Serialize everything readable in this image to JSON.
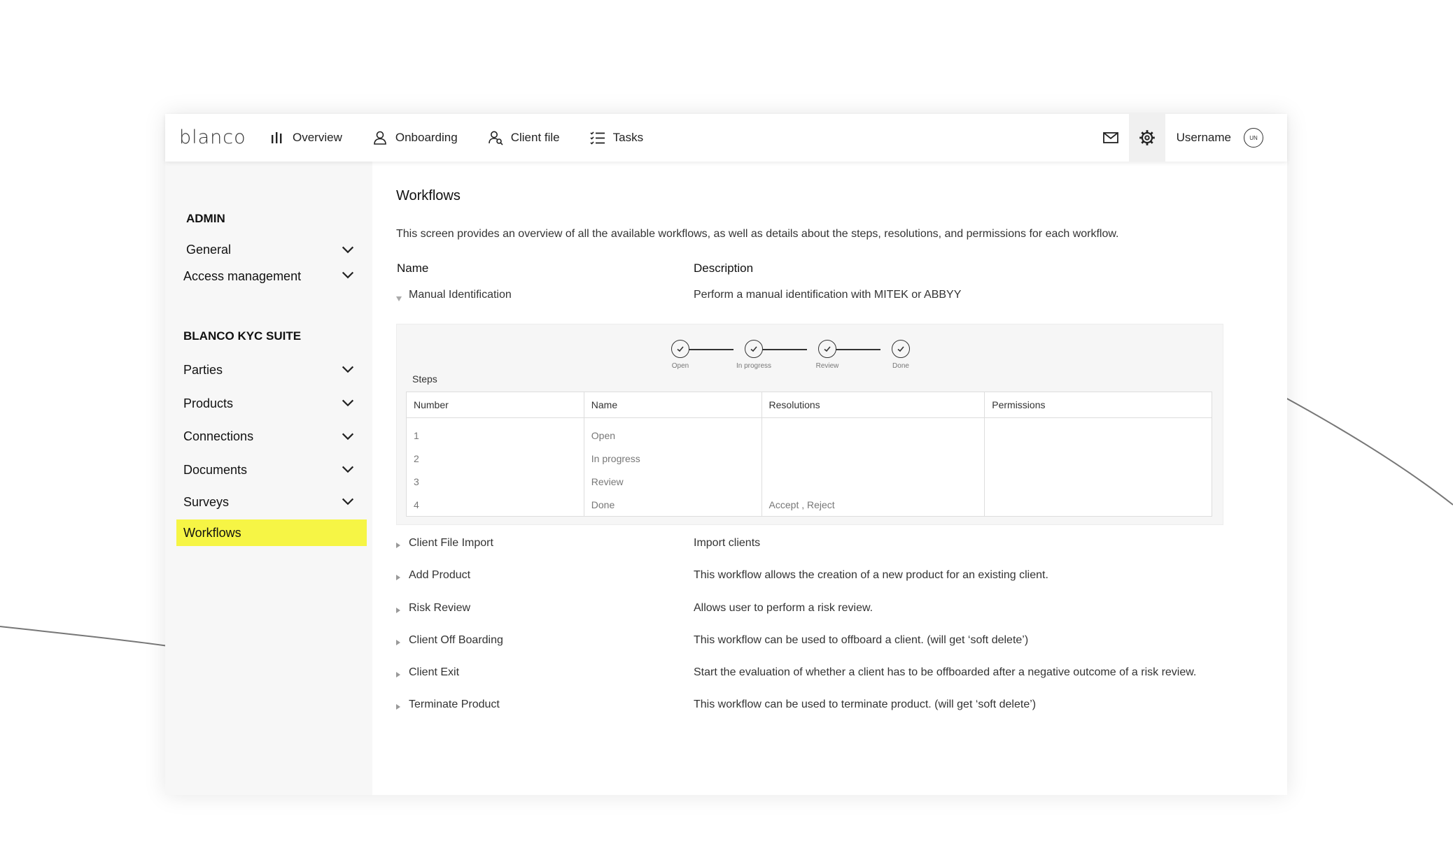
{
  "app": {
    "logo": "blanco"
  },
  "nav": {
    "items": [
      {
        "label": "Overview",
        "icon": "bar-chart-icon"
      },
      {
        "label": "Onboarding",
        "icon": "user-icon"
      },
      {
        "label": "Client file",
        "icon": "user-search-icon"
      },
      {
        "label": "Tasks",
        "icon": "task-list-icon"
      }
    ],
    "username": "Username",
    "avatar_initials": "UN"
  },
  "sidebar": {
    "admin_title": "ADMIN",
    "admin_items": [
      {
        "label": "General"
      },
      {
        "label": "Access management"
      }
    ],
    "suite_title": "BLANCO KYC SUITE",
    "suite_items": [
      {
        "label": "Parties"
      },
      {
        "label": "Products"
      },
      {
        "label": "Connections"
      },
      {
        "label": "Documents"
      },
      {
        "label": "Surveys"
      },
      {
        "label": "Workflows",
        "active": true
      }
    ],
    "active_color": "#f6f545"
  },
  "main": {
    "title": "Workflows",
    "intro": "This screen provides an overview of all the available workflows, as well as details about the steps, resolutions, and permissions for each workflow.",
    "col_name": "Name",
    "col_description": "Description",
    "workflows": [
      {
        "name": "Manual Identification",
        "description": "Perform a manual identification with MITEK or ABBYY",
        "expanded": true
      },
      {
        "name": "Client File Import",
        "description": "Import clients"
      },
      {
        "name": "Add Product",
        "description": "This workflow allows the creation of a new product for an existing client."
      },
      {
        "name": "Risk Review",
        "description": "Allows user to perform a risk review."
      },
      {
        "name": "Client Off Boarding",
        "description": "This workflow can be used to offboard a client. (will get ‘soft delete’)"
      },
      {
        "name": "Client Exit",
        "description": "Start the evaluation of whether a client has to be offboarded after a negative outcome of a risk review."
      },
      {
        "name": "Terminate Product",
        "description": "This workflow can be used to terminate product. (will get ‘soft delete’)"
      }
    ],
    "panel": {
      "stepper": [
        "Open",
        "In progress",
        "Review",
        "Done"
      ],
      "steps_label": "Steps",
      "columns": [
        "Number",
        "Name",
        "Resolutions",
        "Permissions"
      ],
      "rows": [
        {
          "number": "1",
          "name": "Open",
          "resolutions": "",
          "permissions": ""
        },
        {
          "number": "2",
          "name": "In progress",
          "resolutions": "",
          "permissions": ""
        },
        {
          "number": "3",
          "name": "Review",
          "resolutions": "",
          "permissions": ""
        },
        {
          "number": "4",
          "name": "Done",
          "resolutions": "Accept , Reject",
          "permissions": ""
        }
      ]
    }
  }
}
